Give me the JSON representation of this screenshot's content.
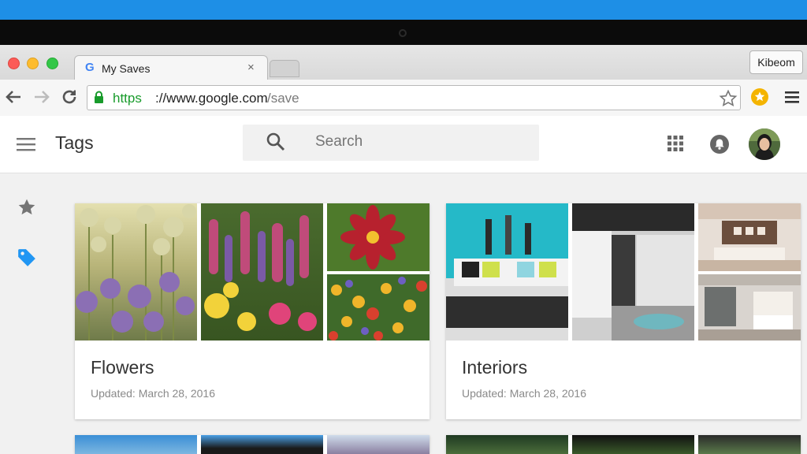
{
  "browser": {
    "tab_title": "My Saves",
    "tab_close_glyph": "×",
    "tab_favicon": "G",
    "profile_name": "Kibeom",
    "url_scheme": "https",
    "url_host": "://www.google.com",
    "url_path": "/save",
    "nav_icons": [
      "back-arrow-icon",
      "forward-arrow-icon",
      "reload-icon"
    ],
    "toolbar_icons": [
      "lock-icon",
      "bookmark-star-icon",
      "extension-star-icon",
      "chrome-menu-icon"
    ]
  },
  "appbar": {
    "title": "Tags",
    "search_placeholder": "Search",
    "icons": [
      "hamburger-icon",
      "search-icon",
      "apps-grid-icon",
      "notifications-icon",
      "avatar"
    ]
  },
  "sidebar": {
    "items": [
      {
        "icon": "star-icon",
        "color": "#757575"
      },
      {
        "icon": "tag-icon",
        "color": "#2196f3"
      }
    ]
  },
  "cards": [
    {
      "title": "Flowers",
      "updated": "Updated: March 28, 2016"
    },
    {
      "title": "Interiors",
      "updated": "Updated: March 28, 2016"
    }
  ],
  "colors": {
    "desktop_blue": "#1e8fe6",
    "https_green": "#189b2b",
    "tag_blue": "#2196f3",
    "extension_gold": "#f4b400"
  }
}
